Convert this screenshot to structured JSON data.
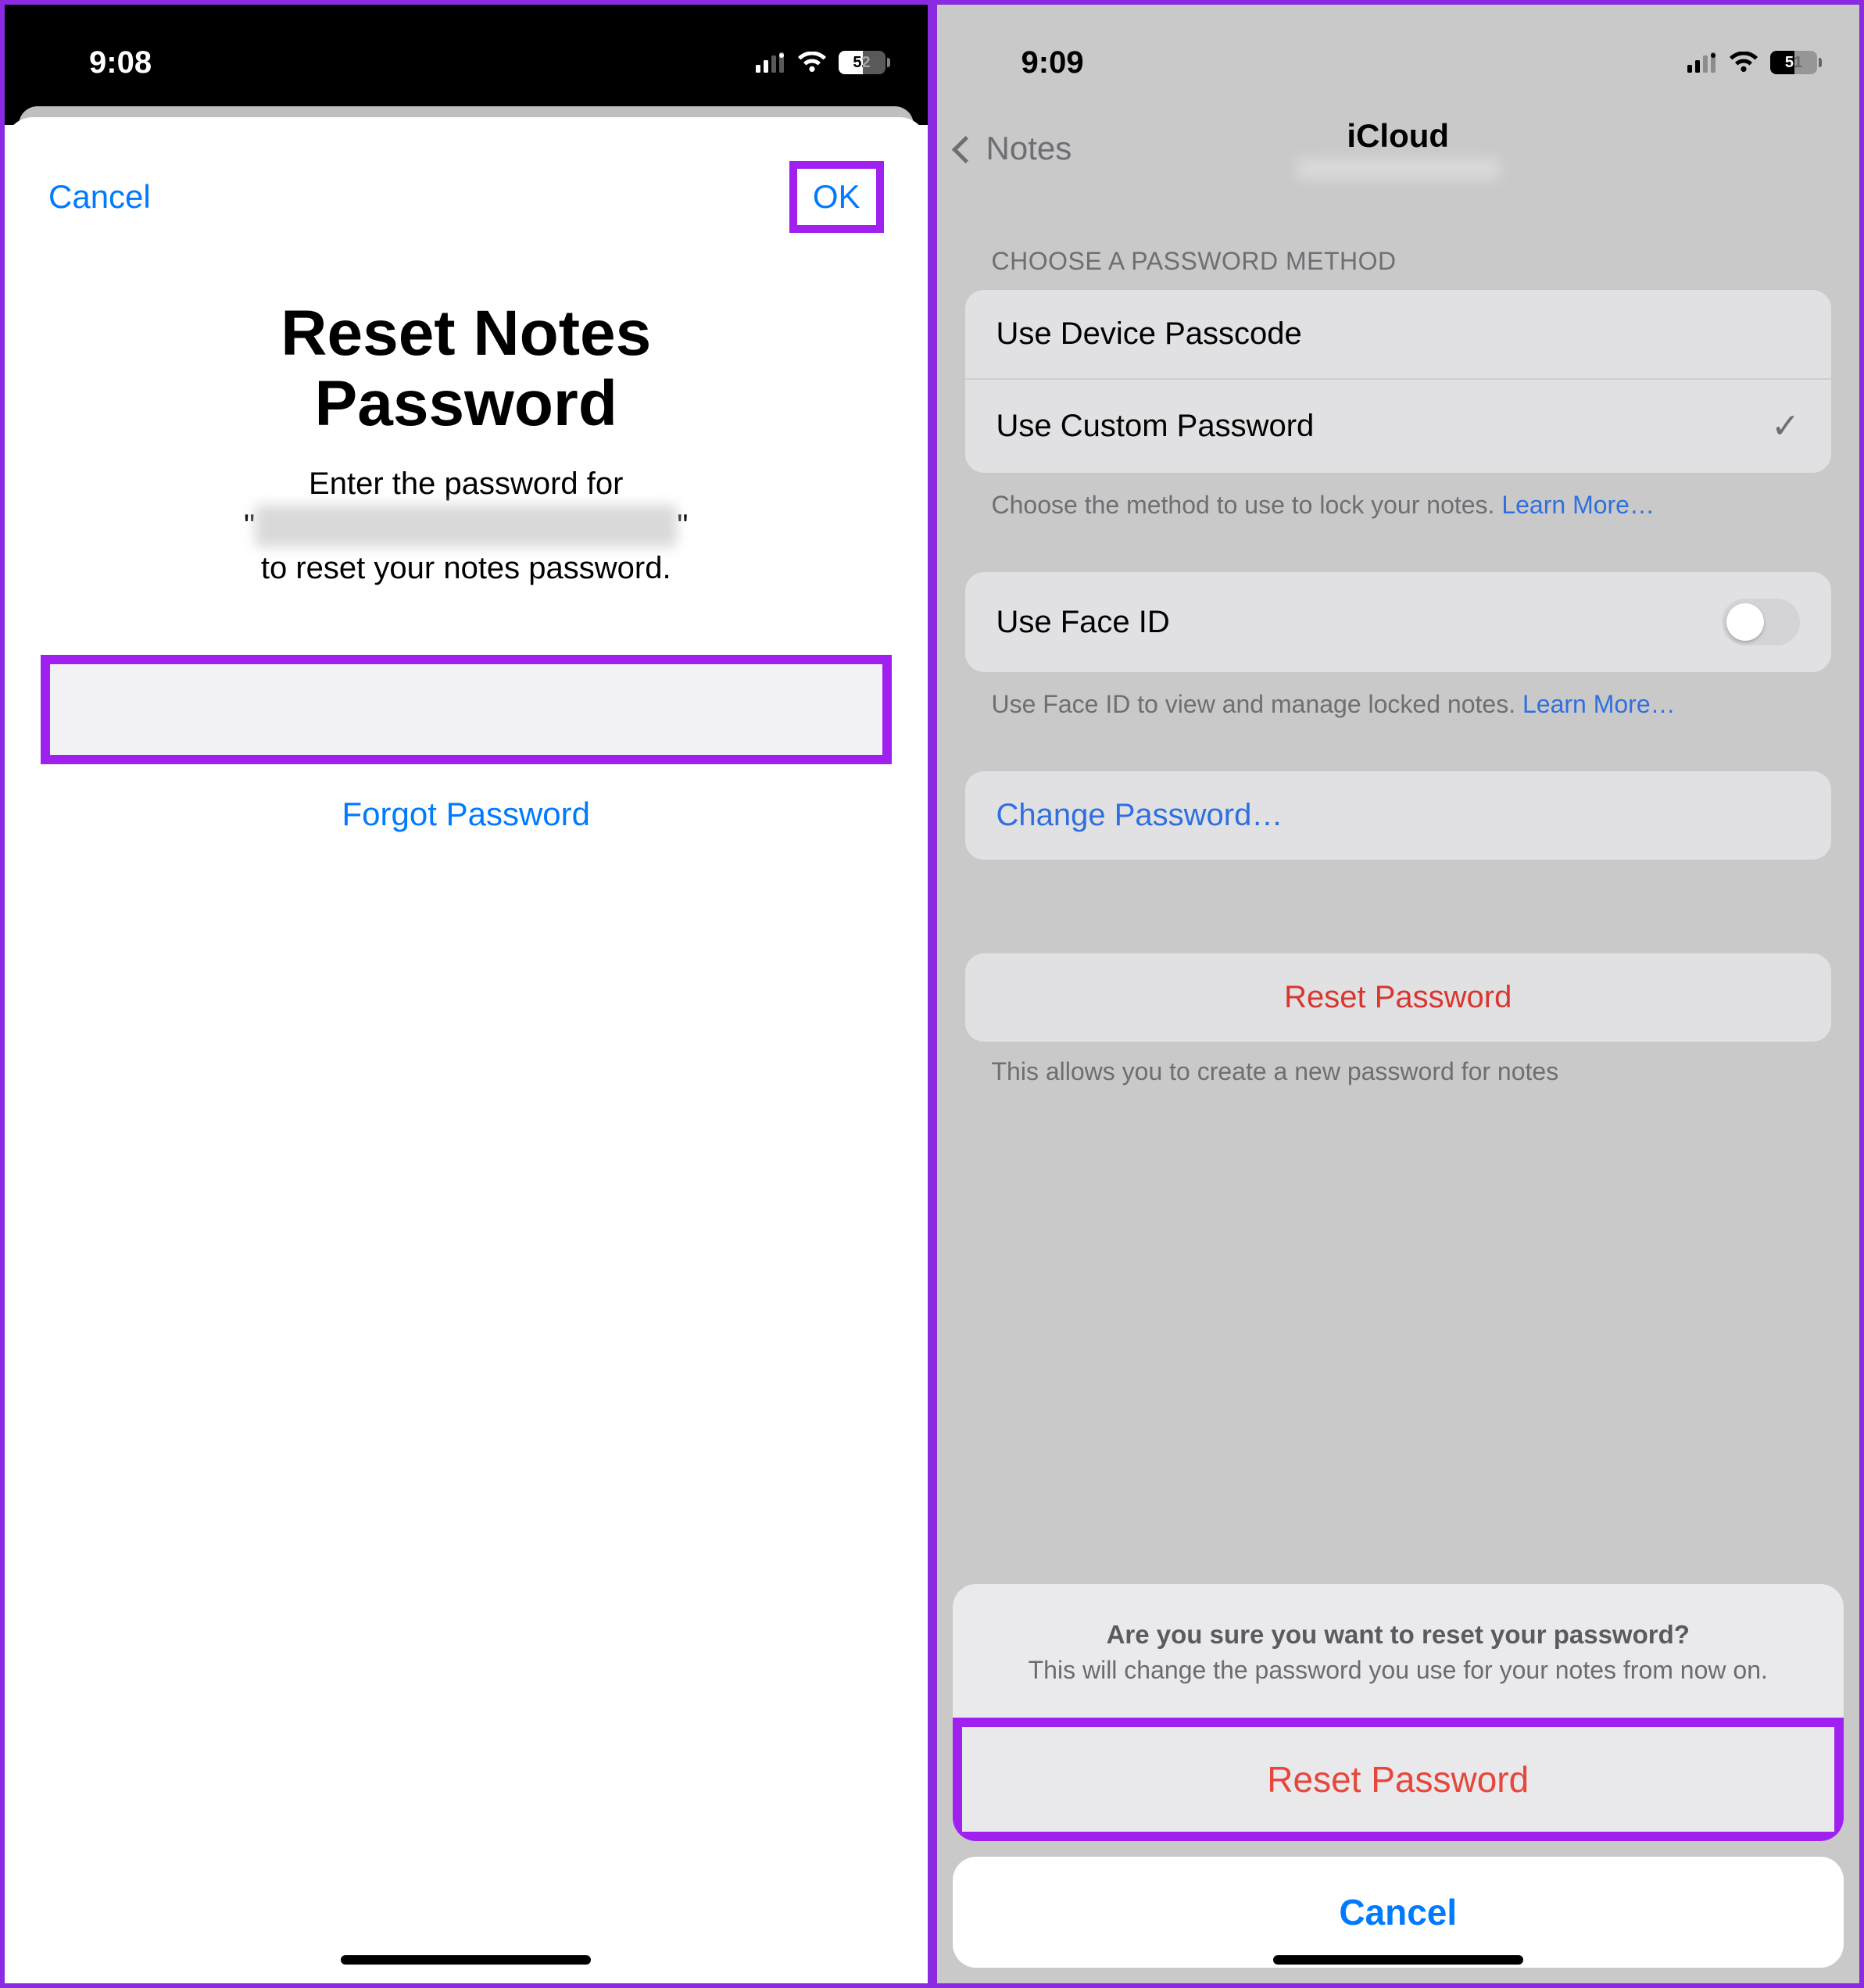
{
  "left": {
    "status": {
      "time": "9:08",
      "battery": "52"
    },
    "nav": {
      "cancel": "Cancel",
      "ok": "OK"
    },
    "title_line1": "Reset Notes",
    "title_line2": "Password",
    "subtitle_pre": "Enter the password for",
    "subtitle_quote_open": "\"",
    "subtitle_quote_close": "\"",
    "subtitle_post": "to reset your notes password.",
    "forgot": "Forgot Password"
  },
  "right": {
    "status": {
      "time": "9:09",
      "battery": "51"
    },
    "nav": {
      "back": "Notes",
      "title": "iCloud"
    },
    "section1_header": "CHOOSE A PASSWORD METHOD",
    "row_device_passcode": "Use Device Passcode",
    "row_custom_password": "Use Custom Password",
    "footer1_text": "Choose the method to use to lock your notes. ",
    "footer1_link": "Learn More…",
    "row_faceid": "Use Face ID",
    "footer2_text": "Use Face ID to view and manage locked notes. ",
    "footer2_link": "Learn More…",
    "row_change_password": "Change Password…",
    "row_reset_password": "Reset Password",
    "reset_footer": "This allows you to create a new password for notes",
    "action_sheet": {
      "title": "Are you sure you want to reset your password?",
      "message": "This will change the password you use for your notes from now on.",
      "confirm": "Reset Password",
      "cancel": "Cancel"
    }
  }
}
